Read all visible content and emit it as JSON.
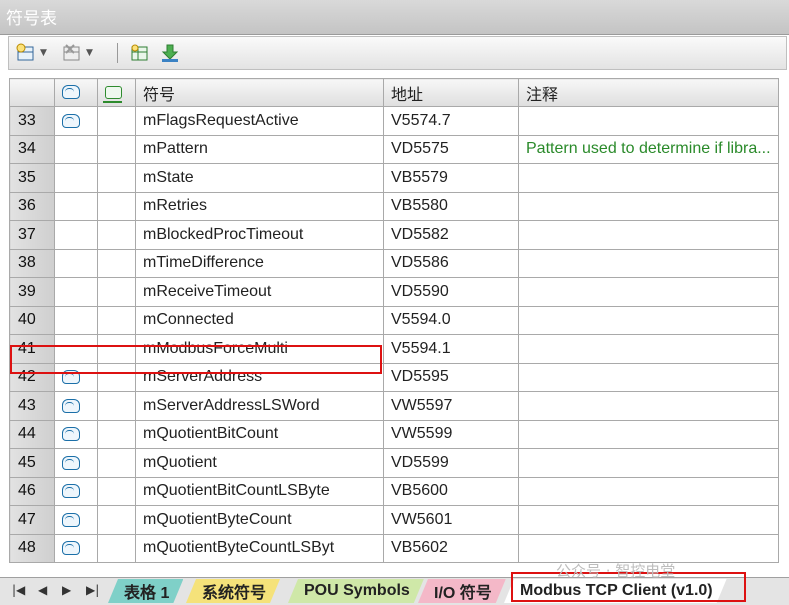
{
  "window": {
    "title": "符号表"
  },
  "columns": {
    "icon1": "",
    "icon2": "",
    "symbol": "符号",
    "address": "地址",
    "comment": "注释"
  },
  "rows": [
    {
      "num": "33",
      "icon": "info",
      "symbol": "mFlagsRequestActive",
      "address": "V5574.7",
      "comment": ""
    },
    {
      "num": "34",
      "icon": "",
      "symbol": "mPattern",
      "address": "VD5575",
      "comment": "Pattern used to determine if libra..."
    },
    {
      "num": "35",
      "icon": "",
      "symbol": "mState",
      "address": "VB5579",
      "comment": ""
    },
    {
      "num": "36",
      "icon": "",
      "symbol": "mRetries",
      "address": "VB5580",
      "comment": ""
    },
    {
      "num": "37",
      "icon": "",
      "symbol": "mBlockedProcTimeout",
      "address": "VD5582",
      "comment": ""
    },
    {
      "num": "38",
      "icon": "",
      "symbol": "mTimeDifference",
      "address": "VD5586",
      "comment": ""
    },
    {
      "num": "39",
      "icon": "",
      "symbol": "mReceiveTimeout",
      "address": "VD5590",
      "comment": ""
    },
    {
      "num": "40",
      "icon": "",
      "symbol": "mConnected",
      "address": "V5594.0",
      "comment": ""
    },
    {
      "num": "41",
      "icon": "",
      "symbol": "mModbusForceMulti",
      "address": "V5594.1",
      "comment": ""
    },
    {
      "num": "42",
      "icon": "info",
      "symbol": "mServerAddress",
      "address": "VD5595",
      "comment": ""
    },
    {
      "num": "43",
      "icon": "info",
      "symbol": "mServerAddressLSWord",
      "address": "VW5597",
      "comment": ""
    },
    {
      "num": "44",
      "icon": "info",
      "symbol": "mQuotientBitCount",
      "address": "VW5599",
      "comment": ""
    },
    {
      "num": "45",
      "icon": "info",
      "symbol": "mQuotient",
      "address": "VD5599",
      "comment": ""
    },
    {
      "num": "46",
      "icon": "info",
      "symbol": "mQuotientBitCountLSByte",
      "address": "VB5600",
      "comment": ""
    },
    {
      "num": "47",
      "icon": "info",
      "symbol": "mQuotientByteCount",
      "address": "VW5601",
      "comment": ""
    },
    {
      "num": "48",
      "icon": "info",
      "symbol": "mQuotientByteCountLSByt",
      "address": "VB5602",
      "comment": ""
    }
  ],
  "tabs": [
    {
      "label": "表格 1",
      "color": "#7fd0c8"
    },
    {
      "label": "系统符号",
      "color": "#f5e27a"
    },
    {
      "label": "POU Symbols",
      "color": "#cfe8a8"
    },
    {
      "label": "I/O 符号",
      "color": "#f4b8c8"
    },
    {
      "label": "Modbus TCP Client (v1.0)",
      "color": "#ffffff"
    }
  ],
  "watermark": "公众号 · 智控电堂"
}
